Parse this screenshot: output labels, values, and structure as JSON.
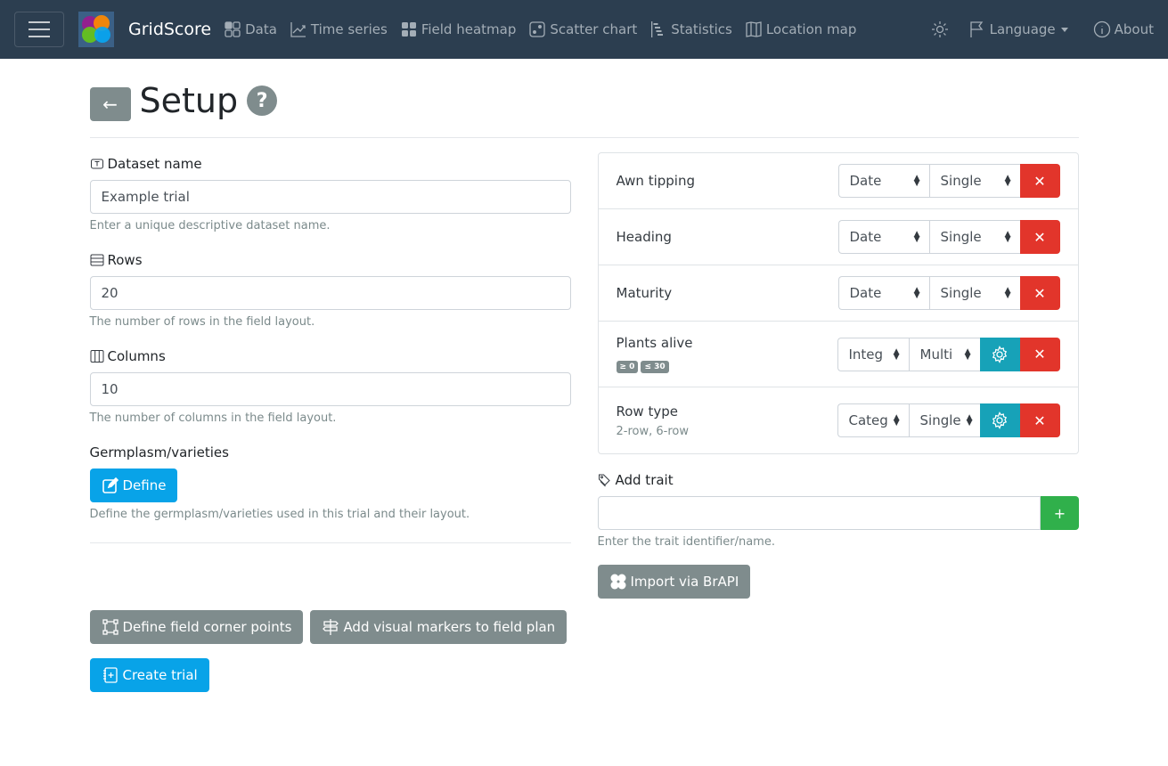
{
  "navbar": {
    "brand": "GridScore",
    "items": [
      {
        "label": "Data",
        "icon": "grid-check-icon"
      },
      {
        "label": "Time series",
        "icon": "line-chart-icon"
      },
      {
        "label": "Field heatmap",
        "icon": "grid-fill-icon"
      },
      {
        "label": "Scatter chart",
        "icon": "dice-icon"
      },
      {
        "label": "Statistics",
        "icon": "bar-chart-steps-icon"
      },
      {
        "label": "Location map",
        "icon": "map-icon"
      }
    ],
    "language": "Language",
    "about": "About"
  },
  "page": {
    "title": "Setup",
    "back": "←",
    "help": "?"
  },
  "form": {
    "dataset_name": {
      "label": "Dataset name",
      "value": "Example trial",
      "help": "Enter a unique descriptive dataset name."
    },
    "rows": {
      "label": "Rows",
      "value": "20",
      "help": "The number of rows in the field layout."
    },
    "columns": {
      "label": "Columns",
      "value": "10",
      "help": "The number of columns in the field layout."
    },
    "germplasm": {
      "label": "Germplasm/varieties",
      "button": "Define",
      "help": "Define the germplasm/varieties used in this trial and their layout."
    },
    "corner_points_button": "Define field corner points",
    "markers_button": "Add visual markers to field plan",
    "create_button": "Create trial"
  },
  "traits": [
    {
      "name": "Awn tipping",
      "type": "Date",
      "mode": "Single"
    },
    {
      "name": "Heading",
      "type": "Date",
      "mode": "Single"
    },
    {
      "name": "Maturity",
      "type": "Date",
      "mode": "Single"
    },
    {
      "name": "Plants alive",
      "type": "Integ",
      "mode": "Multi",
      "badges": [
        "≥ 0",
        "≤ 30"
      ]
    },
    {
      "name": "Row type",
      "type": "Categ",
      "mode": "Single",
      "sub": "2-row, 6-row"
    }
  ],
  "add_trait": {
    "label": "Add trait",
    "value": "",
    "placeholder": "",
    "add": "+",
    "help": "Enter the trait identifier/name.",
    "brapi_button": "Import via BrAPI"
  },
  "colors": {
    "navbar": "#2c3e50",
    "info": "#08a3e8",
    "secondary": "#7f8c8d",
    "danger": "#e2352b",
    "teal": "#17a2b8",
    "success": "#30b04b"
  }
}
